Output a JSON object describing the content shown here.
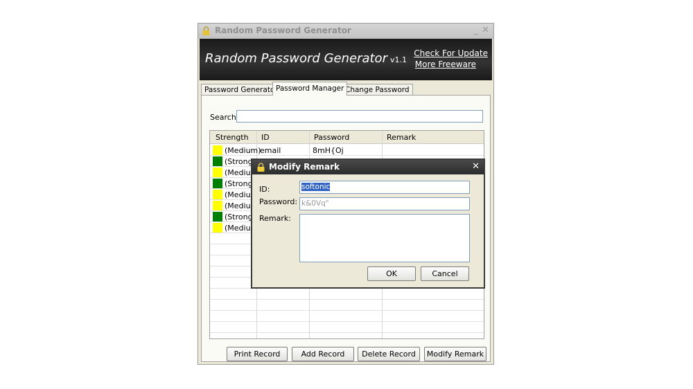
{
  "window": {
    "title": "Random Password Generator",
    "minimize": "_",
    "close": "✕"
  },
  "banner": {
    "title": "Random Password Generator",
    "version": "v1.1",
    "links": [
      "Check For Update",
      "More Freeware"
    ]
  },
  "tabs": [
    {
      "label": "Password Generator",
      "active": false
    },
    {
      "label": "Password Manager",
      "active": true
    },
    {
      "label": "Change Password",
      "active": false
    }
  ],
  "search": {
    "label": "Search:",
    "value": ""
  },
  "table": {
    "headers": [
      "Strength",
      "ID",
      "Password",
      "Remark"
    ],
    "rows": [
      {
        "strength": "(Medium)",
        "id": "email",
        "password": "8mH{Oj",
        "remark": "",
        "color": "#ffff00"
      },
      {
        "strength": "(Strong)",
        "id": "",
        "password": "",
        "remark": "",
        "color": "#008000"
      },
      {
        "strength": "(Medium)",
        "id": "",
        "password": "",
        "remark": "",
        "color": "#ffff00"
      },
      {
        "strength": "(Strong)",
        "id": "",
        "password": "",
        "remark": "",
        "color": "#008000"
      },
      {
        "strength": "(Medium)",
        "id": "",
        "password": "",
        "remark": "",
        "color": "#ffff00"
      },
      {
        "strength": "(Medium)",
        "id": "",
        "password": "",
        "remark": "",
        "color": "#ffff00"
      },
      {
        "strength": "(Strong)",
        "id": "",
        "password": "",
        "remark": "",
        "color": "#008000"
      },
      {
        "strength": "(Medium)",
        "id": "",
        "password": "",
        "remark": "",
        "color": "#ffff00"
      }
    ]
  },
  "buttons": [
    "Print Record",
    "Add Record",
    "Delete Record",
    "Modify Remark"
  ],
  "dialog": {
    "title": "Modify Remark",
    "close": "✕",
    "id_label": "ID:",
    "id_value": "softonic",
    "password_label": "Password:",
    "password_value": "k&0Vq\"",
    "remark_label": "Remark:",
    "remark_value": "",
    "ok": "OK",
    "cancel": "Cancel"
  }
}
